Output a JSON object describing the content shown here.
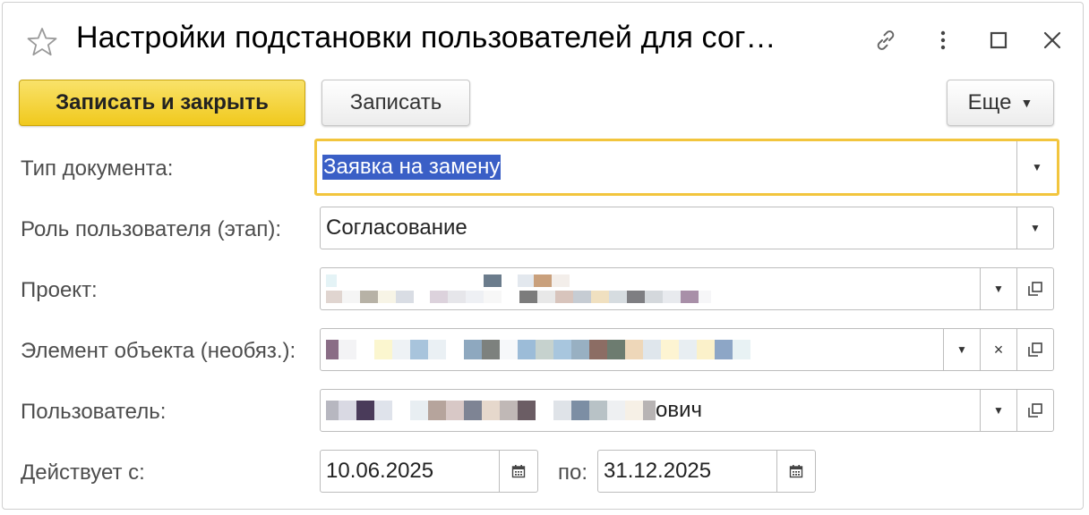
{
  "window": {
    "title": "Настройки подстановки пользователей для сог…"
  },
  "icons": {
    "favorite": "star-icon",
    "link": "link-icon",
    "more": "more-vertical-icon",
    "maximize": "maximize-icon",
    "close": "close-icon"
  },
  "toolbar": {
    "save_close_label": "Записать и закрыть",
    "save_label": "Записать",
    "more_label": "Еще"
  },
  "form": {
    "doc_type": {
      "label": "Тип документа:",
      "value": "Заявка на замену"
    },
    "role": {
      "label": "Роль пользователя (этап):",
      "value": "Согласование"
    },
    "project": {
      "label": "Проект:"
    },
    "object_element": {
      "label": "Элемент объекта (необяз.):"
    },
    "user": {
      "label": "Пользователь:",
      "visible_suffix": "ович"
    },
    "valid": {
      "label": "Действует с:",
      "from": "10.06.2025",
      "to_label": "по:",
      "to": "31.12.2025"
    }
  },
  "colors": {
    "primary_button": "#f0c91d",
    "focus_border": "#f2c53d",
    "selection": "#3a5fc6"
  }
}
